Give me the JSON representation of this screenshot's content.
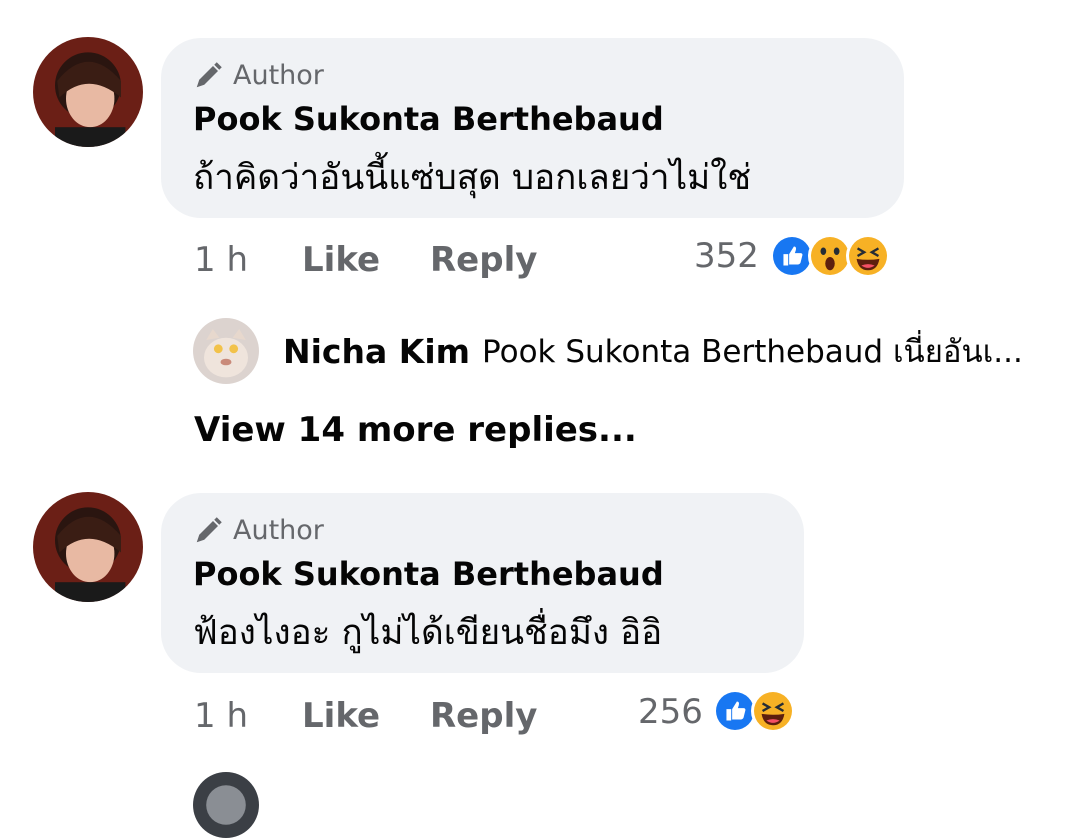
{
  "comments": [
    {
      "badge": "Author",
      "name": "Pook Sukonta Berthebaud",
      "text": "ถ้าคิดว่าอันนี้แซ่บสุด บอกเลยว่าไม่ใช่",
      "time": "1 h",
      "like": "Like",
      "reply": "Reply",
      "reaction_count": "352",
      "reactions": [
        "like-icon",
        "wow-icon",
        "haha-icon"
      ]
    },
    {
      "badge": "Author",
      "name": "Pook Sukonta Berthebaud",
      "text": "ฟ้องไงอะ กูไม่ได้เขียนชื่อมึง อิอิ",
      "time": "1 h",
      "like": "Like",
      "reply": "Reply",
      "reaction_count": "256",
      "reactions": [
        "like-icon",
        "haha-icon"
      ]
    }
  ],
  "reply_preview": {
    "name": "Nicha Kim",
    "text": "Pook Sukonta Berthebaud เนี่ยอันเ..."
  },
  "view_more": "View 14 more replies...",
  "colors": {
    "bubble": "#f0f2f5",
    "secondary_text": "#65676b",
    "like_blue": "#1877f2",
    "emoji_yellow": "#f7b125"
  }
}
